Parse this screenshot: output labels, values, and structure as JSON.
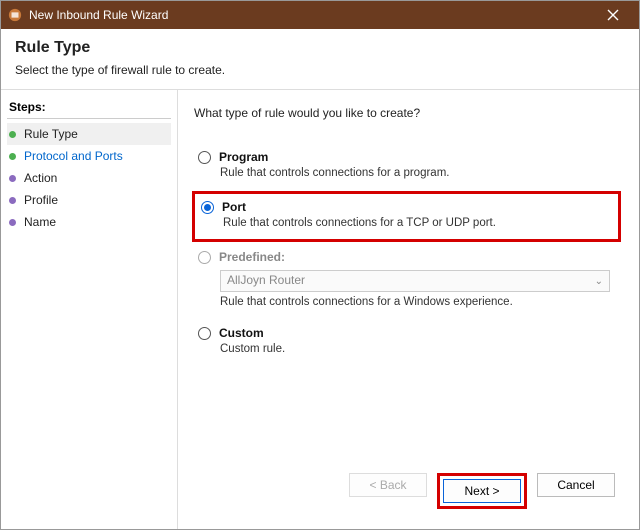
{
  "window": {
    "title": "New Inbound Rule Wizard"
  },
  "header": {
    "title": "Rule Type",
    "subtitle": "Select the type of firewall rule to create."
  },
  "steps": {
    "title": "Steps:",
    "items": [
      {
        "label": "Rule Type",
        "done": true,
        "current": true
      },
      {
        "label": "Protocol and Ports",
        "done": true,
        "active": true
      },
      {
        "label": "Action"
      },
      {
        "label": "Profile"
      },
      {
        "label": "Name"
      }
    ]
  },
  "content": {
    "prompt": "What type of rule would you like to create?",
    "options": {
      "program": {
        "label": "Program",
        "desc": "Rule that controls connections for a program."
      },
      "port": {
        "label": "Port",
        "desc": "Rule that controls connections for a TCP or UDP port."
      },
      "predefined": {
        "label": "Predefined:",
        "desc": "Rule that controls connections for a Windows experience.",
        "selected_value": "AllJoyn Router"
      },
      "custom": {
        "label": "Custom",
        "desc": "Custom rule."
      }
    }
  },
  "buttons": {
    "back": "< Back",
    "next": "Next >",
    "cancel": "Cancel"
  }
}
